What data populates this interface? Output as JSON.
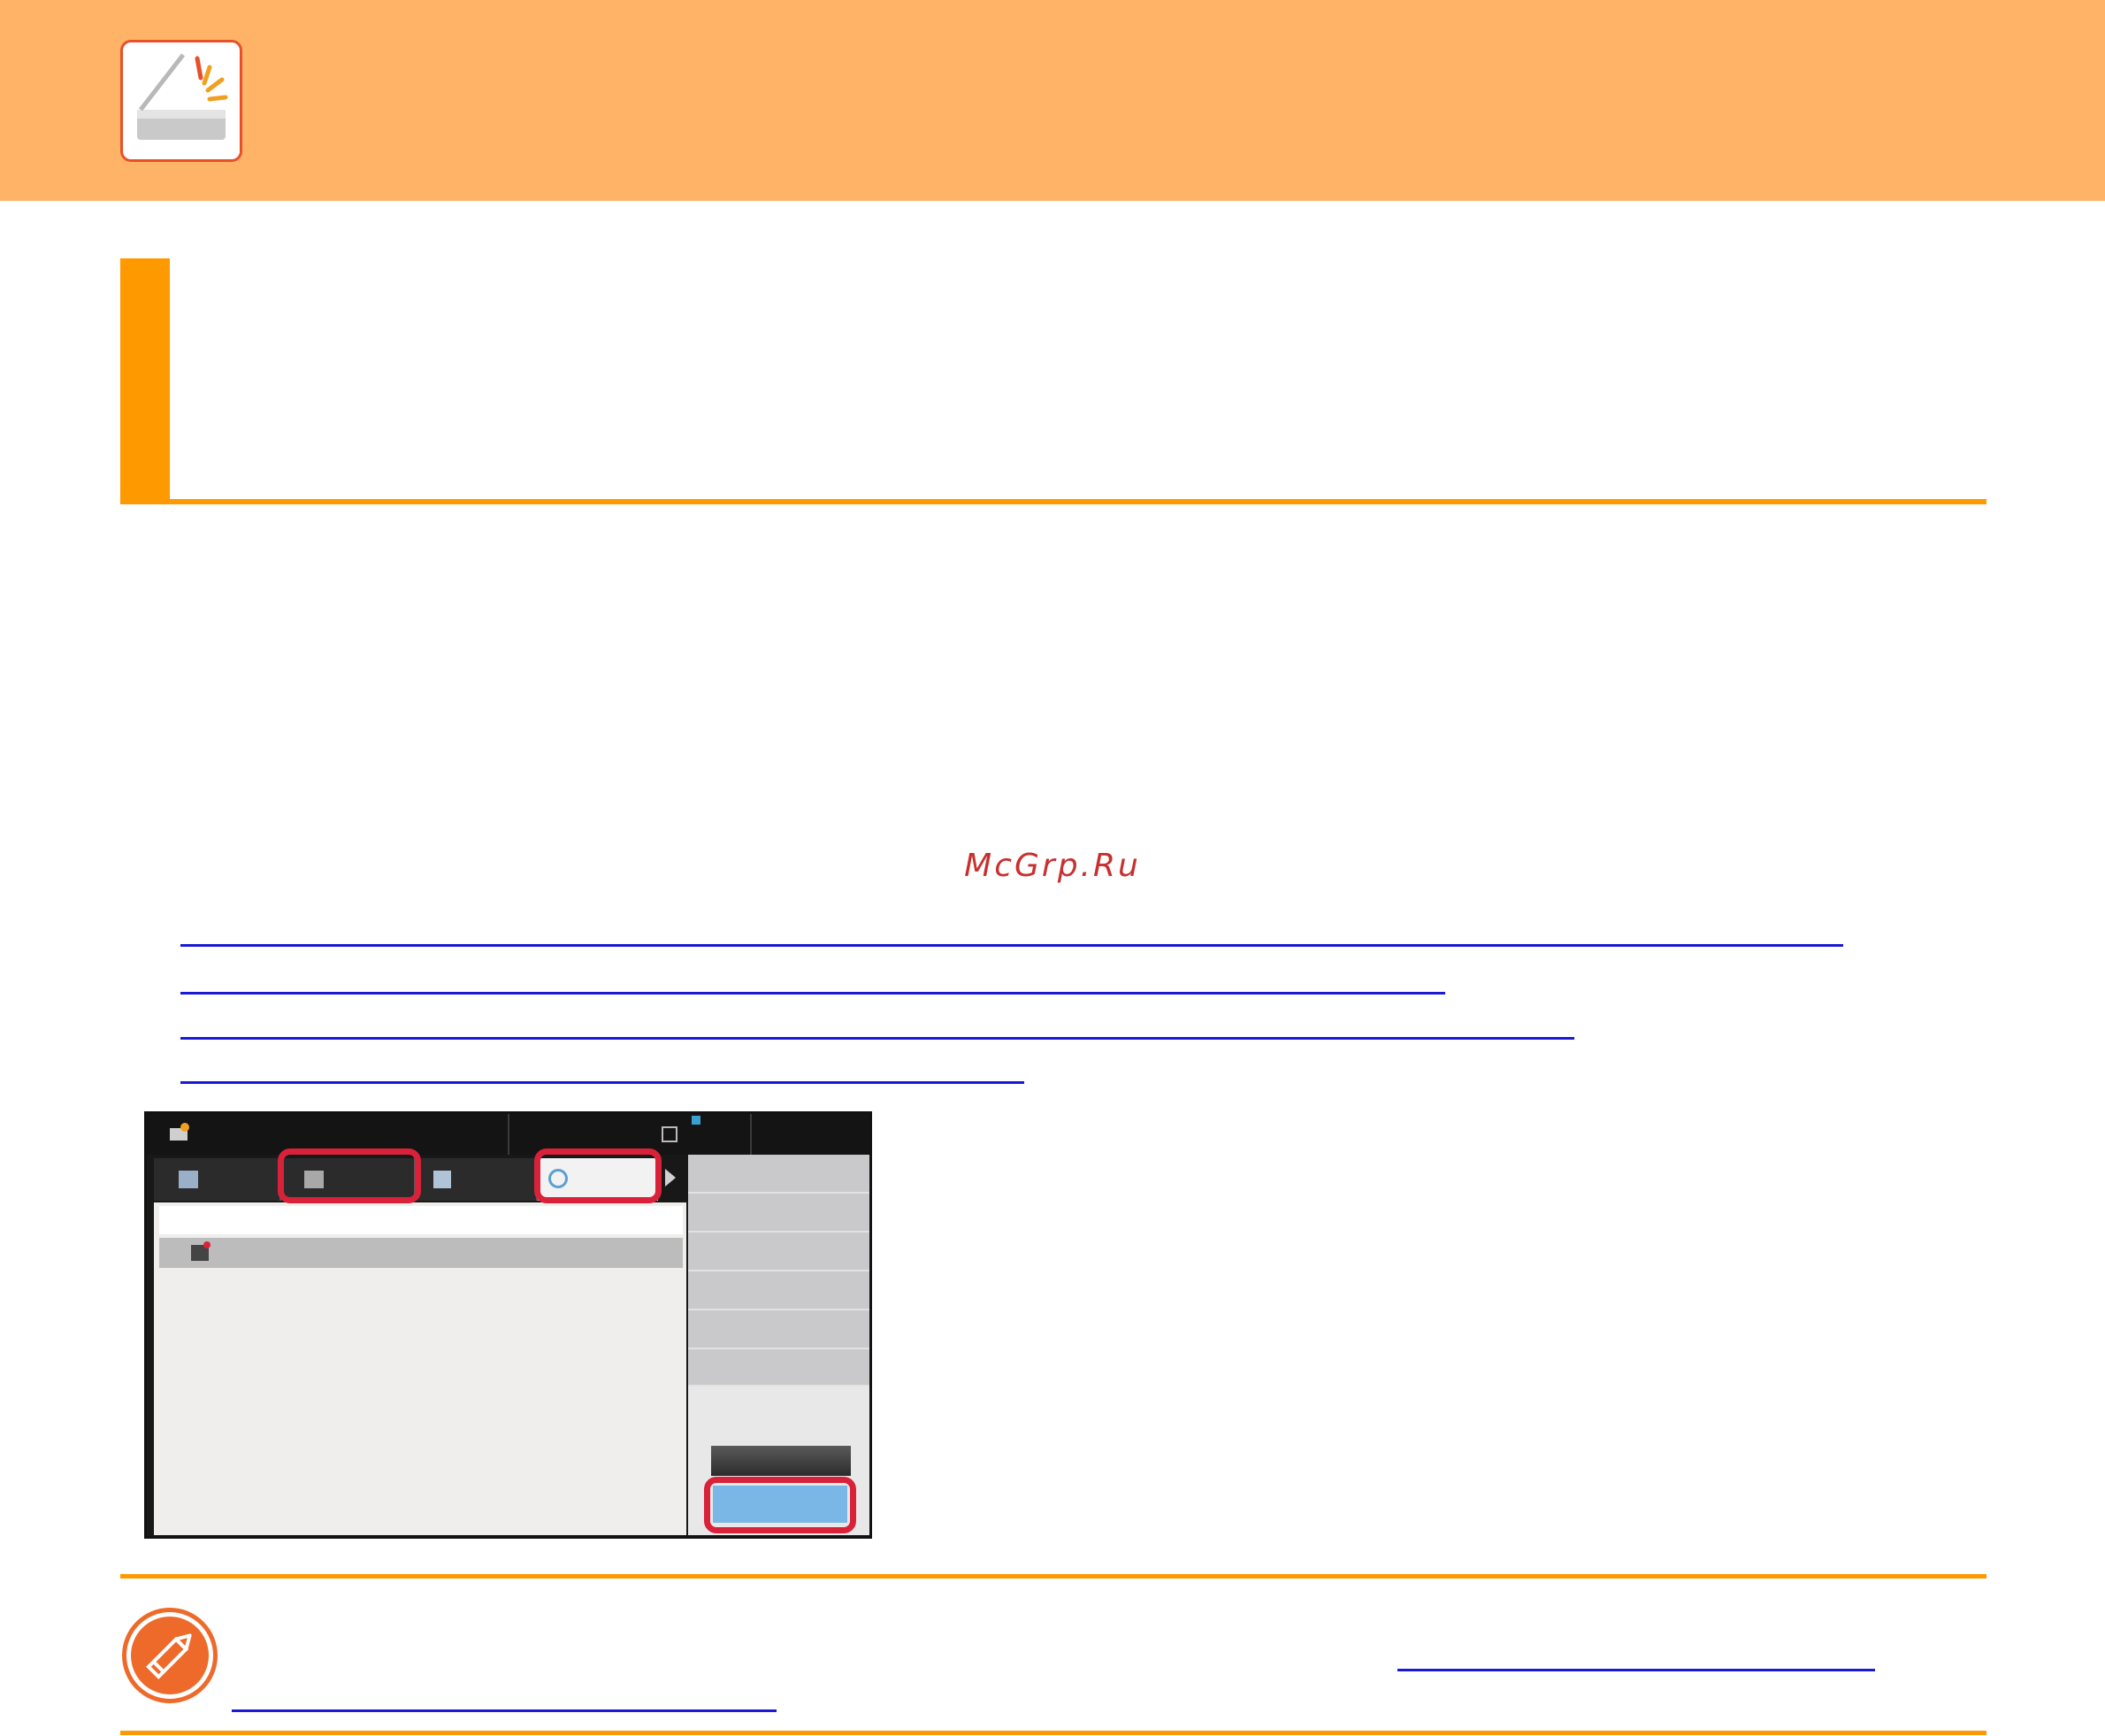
{
  "watermark": {
    "text": "McGrp.Ru"
  },
  "header": {
    "icon": "scanner-icon"
  },
  "note": {
    "icon": "pencil-icon"
  },
  "colors": {
    "header_band": "#ffb366",
    "accent": "#ff9900",
    "highlight": "#d9223a",
    "link": "#1a1ad6"
  }
}
